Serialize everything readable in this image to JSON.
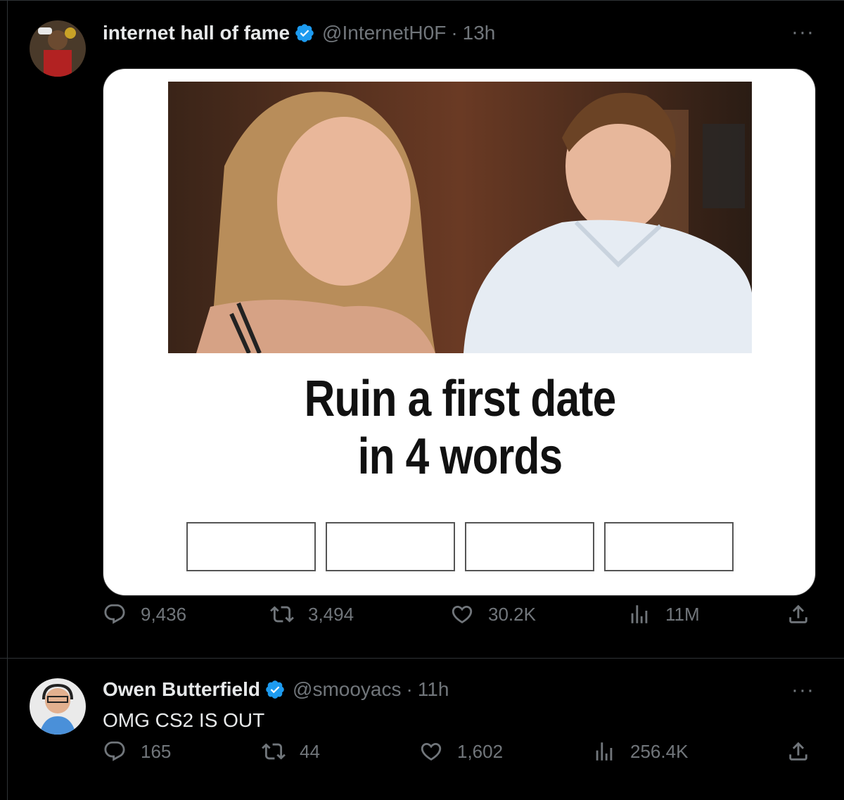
{
  "tweets": [
    {
      "author": {
        "name": "internet hall of fame",
        "handle": "@InternetH0F",
        "verified": true
      },
      "time": "13h",
      "media": {
        "caption_line1": "Ruin a first date",
        "caption_line2": "in 4 words",
        "answer_boxes": 4
      },
      "stats": {
        "replies": "9,436",
        "reposts": "3,494",
        "likes": "30.2K",
        "views": "11M"
      }
    },
    {
      "author": {
        "name": "Owen Butterfield",
        "handle": "@smooyacs",
        "verified": true
      },
      "time": "11h",
      "text": "OMG CS2 IS OUT",
      "stats": {
        "replies": "165",
        "reposts": "44",
        "likes": "1,602",
        "views": "256.4K"
      }
    }
  ],
  "labels": {
    "more": "···",
    "separator": "·"
  },
  "colors": {
    "background": "#000000",
    "text": "#e7e9ea",
    "muted": "#71767b",
    "verified": "#1d9bf0",
    "divider": "#2f3336"
  },
  "icons": [
    "verified-badge-icon",
    "more-icon",
    "reply-icon",
    "repost-icon",
    "like-icon",
    "views-icon",
    "share-icon"
  ]
}
